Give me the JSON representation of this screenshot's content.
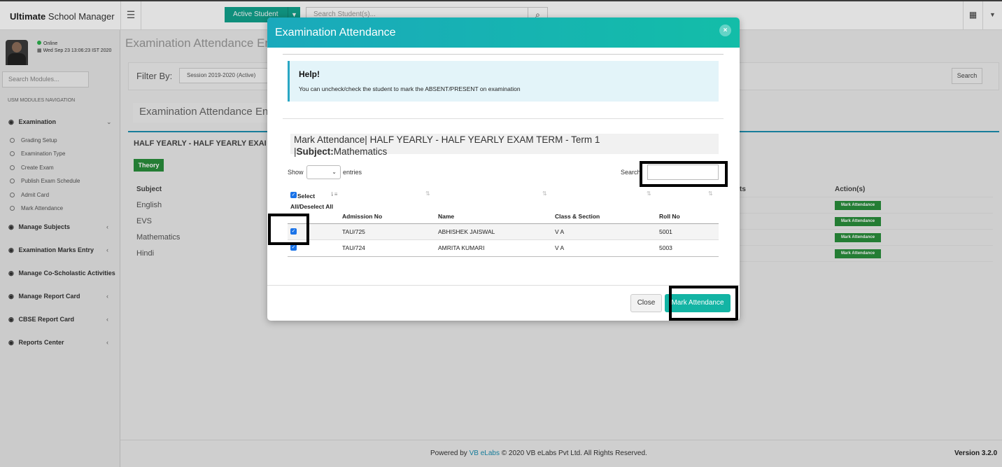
{
  "header": {
    "logo_bold": "Ultimate",
    "logo_rest": " School Manager",
    "active_student_label": "Active Student",
    "search_placeholder": "Search Student(s)..."
  },
  "sidebar": {
    "status": "Online",
    "datetime": "Wed Sep 23 13:06:23 IST 2020",
    "search_placeholder": "Search Modules...",
    "nav_heading": "USM MODULES NAVIGATION",
    "examination": "Examination",
    "exam_items": [
      "Grading Setup",
      "Examination Type",
      "Create Exam",
      "Publish Exam Schedule",
      "Admit Card",
      "Mark Attendance"
    ],
    "modules": [
      "Manage Subjects",
      "Examination Marks Entry",
      "Manage Co-Scholastic Activities",
      "Manage Report Card",
      "CBSE Report Card",
      "Reports Center"
    ]
  },
  "background": {
    "page_title": "Examination Attendance En",
    "filter_label": "Filter By:",
    "session": "Session 2019-2020 (Active)",
    "search_button": "Search",
    "sub_title": "Examination Attendance En",
    "half_yearly": "HALF YEARLY - HALF YEARLY EXAI",
    "theory": "Theory",
    "subject_header": "Subject",
    "subjects": [
      "English",
      "EVS",
      "Mathematics",
      "Hindi"
    ],
    "ts_header": "ts",
    "actions_header": "Action(s)",
    "mark_attendance_small": "Mark Attendance"
  },
  "modal": {
    "title": "Examination Attendance",
    "close_x": "×",
    "help_title": "Help!",
    "help_text": "You can uncheck/check the student to mark the ABSENT/PRESENT on examination",
    "mark_title": "Mark Attendance| HALF YEARLY - HALF YEARLY EXAM TERM - Term 1",
    "subject_label": "Subject:",
    "subject_value": "Mathematics",
    "show_label": "Show",
    "entries_label": "entries",
    "search_label": "Search:",
    "columns": {
      "select_all": "Select All/Deselect All",
      "admission_no": "Admission No",
      "name": "Name",
      "class_section": "Class & Section",
      "roll_no": "Roll No"
    },
    "rows": [
      {
        "admission_no": "TAU/725",
        "name": "ABHISHEK JAISWAL",
        "class_section": "V A",
        "roll_no": "5001"
      },
      {
        "admission_no": "TAU/724",
        "name": "AMRITA KUMARI",
        "class_section": "V A",
        "roll_no": "5003"
      }
    ],
    "close_button": "Close",
    "mark_button": "Mark Attendance"
  },
  "footer": {
    "powered_by": "Powered by ",
    "link": "VB eLabs",
    "copyright": " © 2020 VB eLabs Pvt Ltd. All Rights Reserved.",
    "version": "Version 3.2.0"
  },
  "colors": {
    "accent": "#13b4a4",
    "header_gradient_start": "#1aa9bc",
    "header_gradient_end": "#13bda8",
    "help_bg": "#e3f4f9",
    "green_badge": "#2a8f3c"
  }
}
